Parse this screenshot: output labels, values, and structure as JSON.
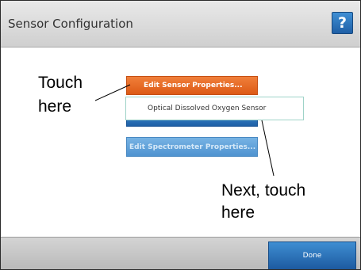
{
  "window": {
    "title": "Sensor Configuration",
    "help_label": "?"
  },
  "menu": {
    "edit_sensor_label": "Edit Sensor Properties...",
    "edit_spectrometer_label": "Edit Spectrometer Properties..."
  },
  "popup": {
    "sensor_option": "Optical Dissolved Oxygen Sensor"
  },
  "footer": {
    "done_label": "Done"
  },
  "annotations": {
    "first_line1": "Touch",
    "first_line2": "here",
    "second_line1": "Next, touch",
    "second_line2": "here"
  },
  "colors": {
    "accent_orange": "#e8692a",
    "accent_blue": "#2a6fb8",
    "disabled_blue": "#62a3da"
  }
}
